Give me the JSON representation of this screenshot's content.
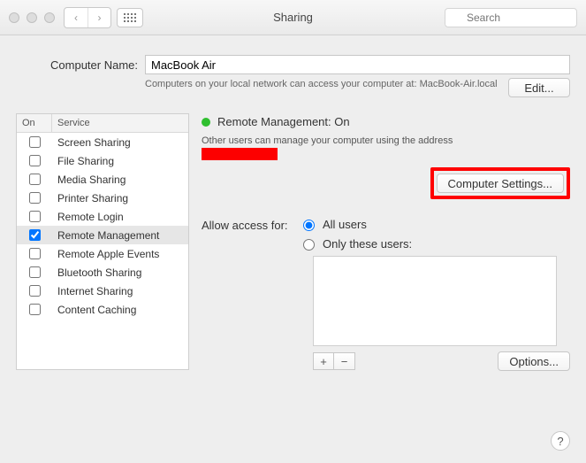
{
  "toolbar": {
    "title": "Sharing",
    "search_placeholder": "Search"
  },
  "computer_name": {
    "label": "Computer Name:",
    "value": "MacBook Air",
    "sub_text": "Computers on your local network can access your computer at: MacBook-Air.local",
    "edit_label": "Edit..."
  },
  "services": {
    "header_on": "On",
    "header_service": "Service",
    "items": [
      {
        "label": "Screen Sharing",
        "checked": false
      },
      {
        "label": "File Sharing",
        "checked": false
      },
      {
        "label": "Media Sharing",
        "checked": false
      },
      {
        "label": "Printer Sharing",
        "checked": false
      },
      {
        "label": "Remote Login",
        "checked": false
      },
      {
        "label": "Remote Management",
        "checked": true
      },
      {
        "label": "Remote Apple Events",
        "checked": false
      },
      {
        "label": "Bluetooth Sharing",
        "checked": false
      },
      {
        "label": "Internet Sharing",
        "checked": false
      },
      {
        "label": "Content Caching",
        "checked": false
      }
    ]
  },
  "detail": {
    "status_title": "Remote Management: On",
    "description": "Other users can manage your computer using the address",
    "computer_settings_label": "Computer Settings...",
    "access_label": "Allow access for:",
    "radio_all": "All users",
    "radio_only": "Only these users:",
    "plus": "+",
    "minus": "−",
    "options_label": "Options..."
  },
  "help": "?"
}
